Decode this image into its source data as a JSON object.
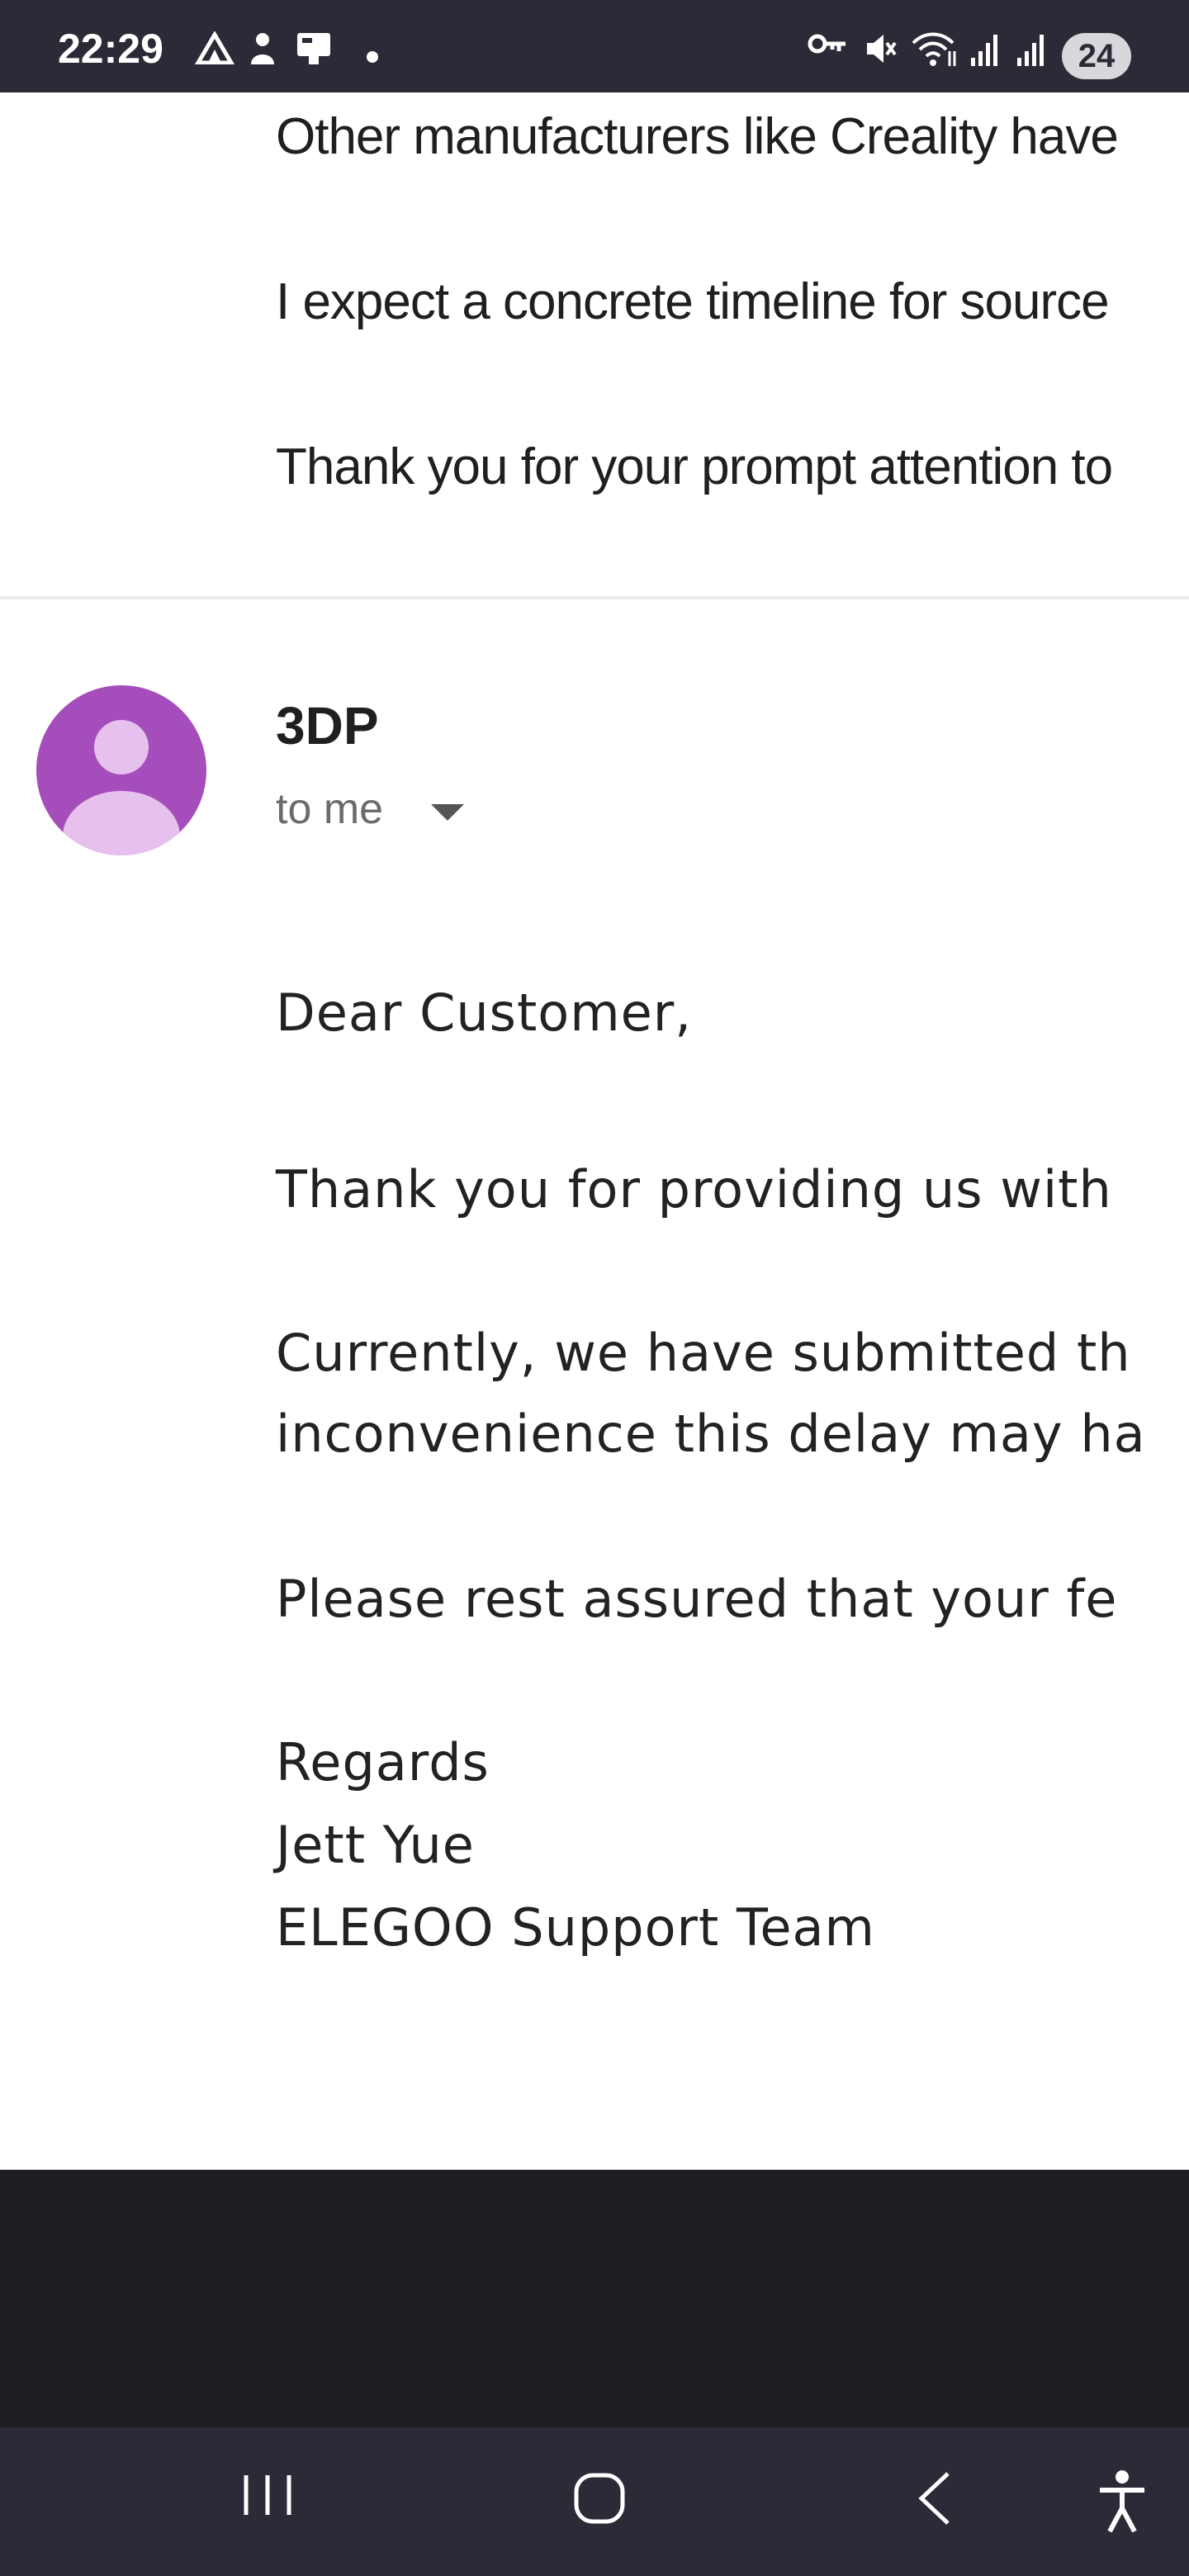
{
  "status_bar": {
    "time": "22:29",
    "battery": "24",
    "icons": [
      "home-app-icon",
      "person-icon",
      "phone-icon",
      "notification-dot",
      "key-icon",
      "mute-icon",
      "wifi-icon",
      "signal-icon",
      "signal-icon-2",
      "battery-icon"
    ]
  },
  "previous_message": {
    "line1": "Other manufacturers like Creality have",
    "line2": "I expect a concrete timeline for source",
    "line3": "Thank you for your prompt attention to"
  },
  "message": {
    "sender": "3DP",
    "recipient_label": "to me",
    "greeting": "Dear Customer,",
    "para1": "Thank you for providing us with",
    "para2_line1": "Currently, we have submitted th",
    "para2_line2": "inconvenience this delay may ha",
    "para3": "Please rest assured that your fe",
    "signoff": "Regards",
    "signer_name": "Jett Yue",
    "signer_team": "ELEGOO Support Team"
  },
  "navigation": {
    "icons": [
      "recent-apps-icon",
      "home-icon",
      "back-icon",
      "accessibility-icon"
    ]
  },
  "colors": {
    "status_bar_bg": "#2b2a36",
    "avatar_bg": "#a64dbc",
    "avatar_fg": "#e6c1ee",
    "footer_dark": "#1f1e22"
  }
}
